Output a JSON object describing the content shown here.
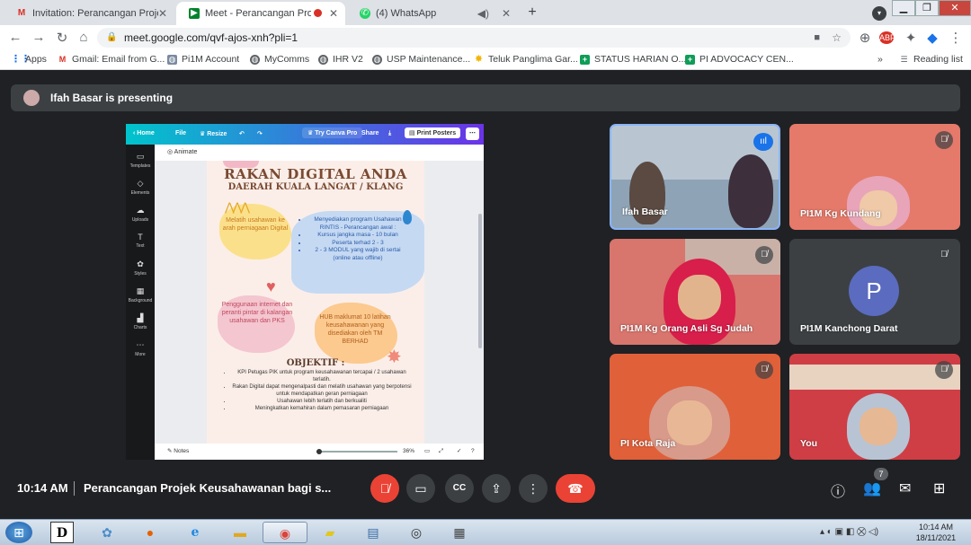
{
  "browser": {
    "tabs": [
      {
        "label": "Invitation: Perancangan Projek Ke",
        "icon": "gmail-icon",
        "active": false
      },
      {
        "label": "Meet - Perancangan Projek K",
        "icon": "meet-icon",
        "active": true
      },
      {
        "label": "(4) WhatsApp",
        "icon": "whatsapp-icon",
        "active": false
      }
    ],
    "url": "meet.google.com/qvf-ajos-xnh?pli=1",
    "bookmarks": [
      {
        "label": "Apps",
        "icon": "apps-icon"
      },
      {
        "label": "Gmail: Email from G...",
        "icon": "gmail-icon"
      },
      {
        "label": "Pi1M Account",
        "icon": "globe-icon"
      },
      {
        "label": "MyComms",
        "icon": "globe-icon"
      },
      {
        "label": "IHR V2",
        "icon": "globe-icon"
      },
      {
        "label": "USP Maintenance...",
        "icon": "globe-icon"
      },
      {
        "label": "Teluk Panglima Gar...",
        "icon": "star-icon"
      },
      {
        "label": "STATUS HARIAN O...",
        "icon": "sheets-icon"
      },
      {
        "label": "PI ADVOCACY CEN...",
        "icon": "sheets-icon"
      }
    ],
    "reading_list": "Reading list"
  },
  "meet": {
    "presenting": "Ifah Basar is presenting",
    "time": "10:14 AM",
    "meeting_title": "Perancangan Projek Keusahawanan bagi s...",
    "participants_count": "7",
    "tiles": [
      {
        "name": "Ifah Basar"
      },
      {
        "name": "PI1M Kg Kundang"
      },
      {
        "name": "PI1M Kg Orang Asli Sg Judah"
      },
      {
        "name": "PI1M Kanchong Darat",
        "initial": "P"
      },
      {
        "name": "PI Kota Raja"
      },
      {
        "name": "You"
      }
    ]
  },
  "canva": {
    "menu": [
      "Home",
      "File",
      "Resize",
      "Try Canva Pro",
      "Share",
      "Print Posters"
    ],
    "side": [
      "Templates",
      "Elements",
      "Uploads",
      "Text",
      "Styles",
      "Background",
      "Charts",
      "More"
    ],
    "animate": "Animate",
    "notes": "Notes",
    "zoom": "36%",
    "poster": {
      "title": "RAKAN DIGITAL ANDA",
      "subtitle": "DAERAH KUALA LANGAT / KLANG",
      "box1": "Melatih usahawan ke arah perniagaan Digital",
      "box2": [
        "Menyediakan program Usahawan RINTIS - Perancangan awal :",
        "Kursus jangka masa - 10 bulan",
        "Peserta terhad 2 - 3",
        "2 - 3 MODUL yang wajib di sertai (online atau offline)"
      ],
      "box3": "Penggunaan internet dan peranti pintar di kalangan usahawan dan PKS",
      "box4": "HUB maklumat 10 latihan keusahawanan yang disediakan oleh TM BERHAD",
      "objektif_title": "OBJEKTIF :",
      "objektif": [
        "KPI Petugas PIK untuk program keusahawanan tercapai / 2 usahawan terlatih.",
        "Rakan Digital dapat mengenalpasti dan melatih usahawan yang berpotensi untuk mendapatkan geran perniagaan",
        "Usahawan lebih terlatih dan berkualiti",
        "Meningkatkan kemahiran dalam pemasaran perniagaan"
      ]
    }
  },
  "taskbar": {
    "time": "10:14 AM",
    "date": "18/11/2021"
  }
}
